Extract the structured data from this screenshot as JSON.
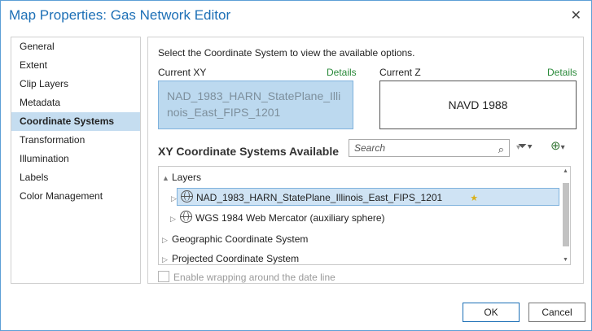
{
  "window": {
    "title": "Map Properties: Gas Network Editor"
  },
  "sidebar": {
    "items": [
      "General",
      "Extent",
      "Clip Layers",
      "Metadata",
      "Coordinate Systems",
      "Transformation",
      "Illumination",
      "Labels",
      "Color Management"
    ],
    "active": "Coordinate Systems"
  },
  "main": {
    "instruction": "Select the Coordinate System to view the available options.",
    "current_xy_label": "Current XY",
    "current_xy_details": "Details",
    "current_xy_value": "NAD_1983_HARN_StatePlane_Illinois_East_FIPS_1201",
    "current_z_label": "Current Z",
    "current_z_details": "Details",
    "current_z_value": "NAVD 1988",
    "section_title": "XY Coordinate Systems Available",
    "search_placeholder": "Search",
    "tree": {
      "layers": "Layers",
      "item1": "NAD_1983_HARN_StatePlane_Illinois_East_FIPS_1201",
      "item2": "WGS 1984 Web Mercator (auxiliary sphere)",
      "geo": "Geographic Coordinate System",
      "proj": "Projected Coordinate System"
    },
    "wrap_label": "Enable wrapping around the date line"
  },
  "buttons": {
    "ok": "OK",
    "cancel": "Cancel"
  },
  "colors": {
    "accent": "#1c6fb6",
    "selection": "#c5ddf0",
    "link": "#2a8a3a"
  },
  "icons": [
    "close-icon",
    "search-icon",
    "filter-icon",
    "globe-add-icon",
    "globe-icon",
    "star-icon"
  ]
}
